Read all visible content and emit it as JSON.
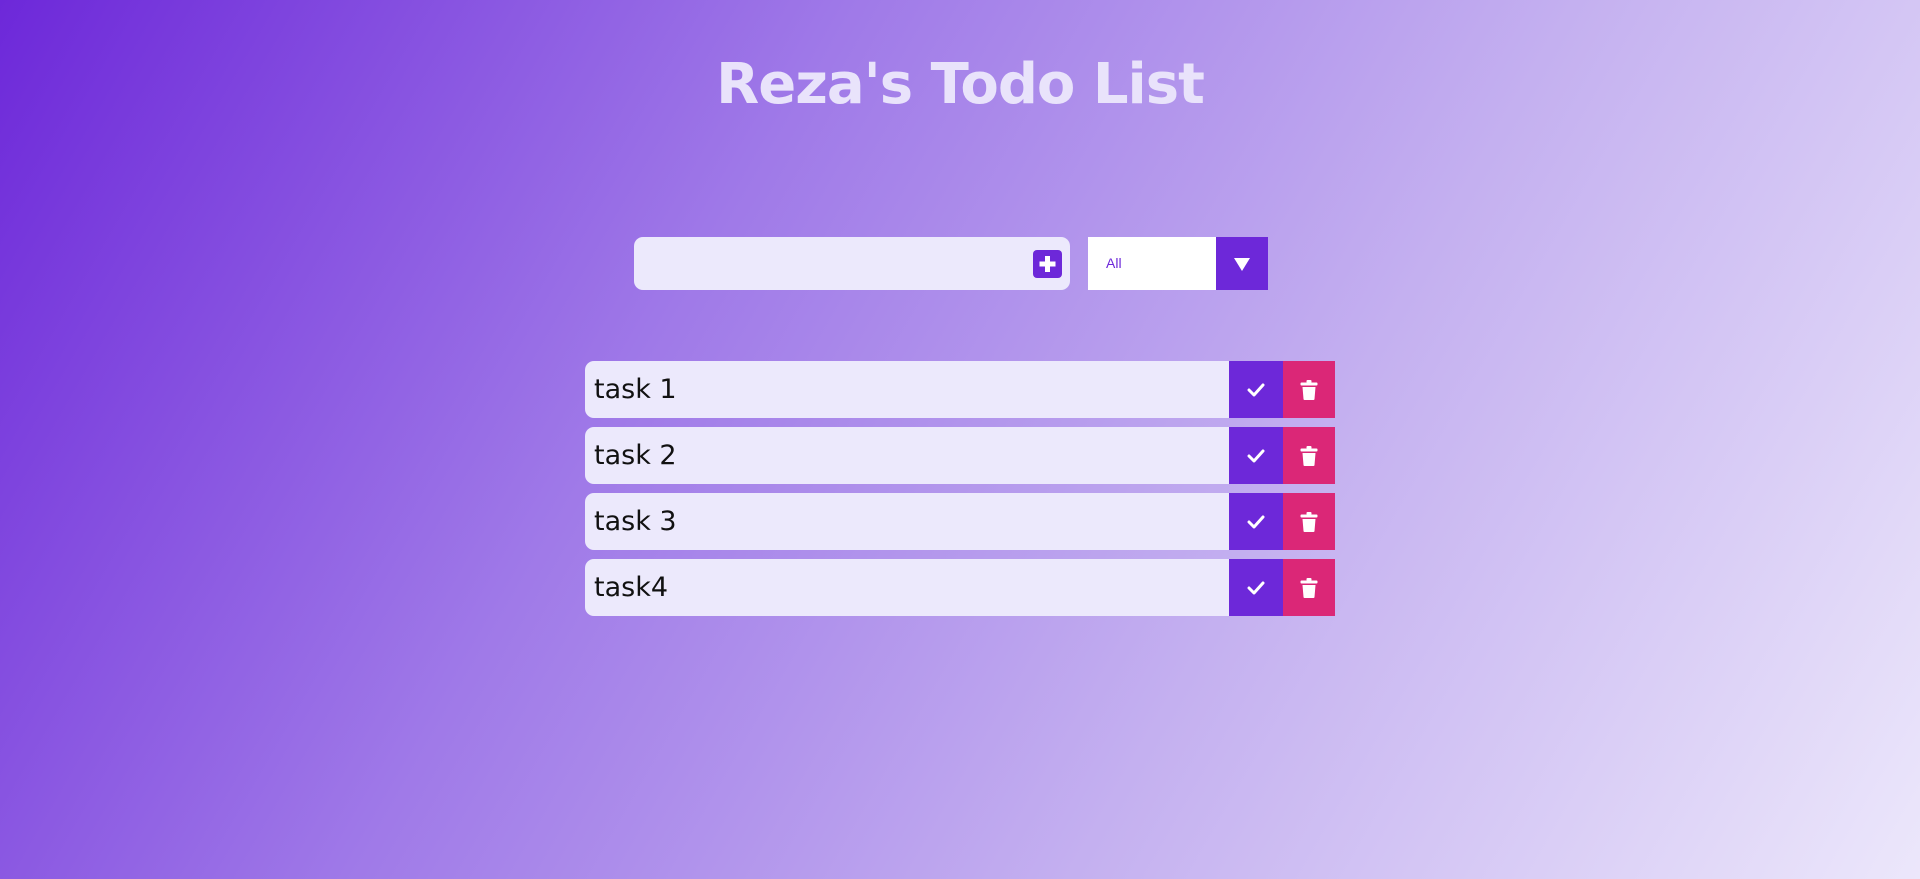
{
  "page": {
    "title": "Reza's Todo List"
  },
  "form": {
    "input_value": "",
    "add_icon": "plus-square-icon",
    "filter_selected": "All",
    "filter_icon": "caret-down-icon"
  },
  "todos": [
    {
      "text": "task 1"
    },
    {
      "text": "task 2"
    },
    {
      "text": "task 3"
    },
    {
      "text": "task4"
    }
  ],
  "icons": {
    "complete": "check-icon",
    "delete": "trash-icon"
  },
  "colors": {
    "accent": "#6d28d9",
    "delete": "#db2777",
    "item_bg": "#ece9fc",
    "title": "#e9e3fb"
  }
}
